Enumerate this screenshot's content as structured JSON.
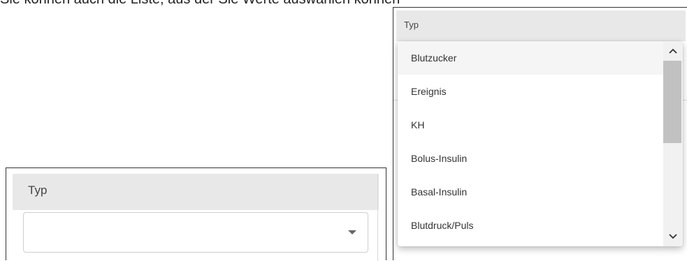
{
  "background_text": "Sie können auch die Liste, aus der Sie Werte auswählen können",
  "left_panel": {
    "header_label": "Typ",
    "select_value": ""
  },
  "right_panel": {
    "header_label": "Typ"
  },
  "dropdown": {
    "options": [
      "Blutzucker",
      "Ereignis",
      "KH",
      "Bolus-Insulin",
      "Basal-Insulin",
      "Blutdruck/Puls"
    ],
    "active_index": 0
  },
  "icons": {
    "scroll_up": "chevron-up-icon",
    "scroll_down": "chevron-down-icon",
    "select_arrow": "caret-down-icon"
  }
}
